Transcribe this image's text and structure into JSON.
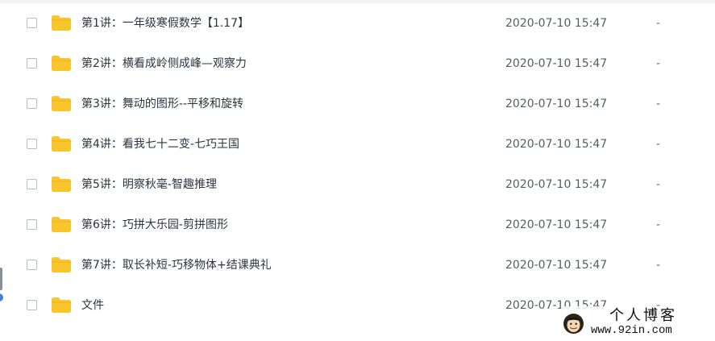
{
  "file_list": {
    "rows": [
      {
        "name": "第1讲：一年级寒假数学【1.17】",
        "date": "2020-07-10 15:47",
        "size": "-"
      },
      {
        "name": "第2讲：横看成岭侧成峰—观察力",
        "date": "2020-07-10 15:47",
        "size": "-"
      },
      {
        "name": "第3讲：舞动的图形--平移和旋转",
        "date": "2020-07-10 15:47",
        "size": "-"
      },
      {
        "name": "第4讲：看我七十二变-七巧王国",
        "date": "2020-07-10 15:47",
        "size": "-"
      },
      {
        "name": "第5讲：明察秋毫-智趣推理",
        "date": "2020-07-10 15:47",
        "size": "-"
      },
      {
        "name": "第6讲：巧拼大乐园-剪拼图形",
        "date": "2020-07-10 15:47",
        "size": "-"
      },
      {
        "name": "第7讲：取长补短-巧移物体+结课典礼",
        "date": "2020-07-10 15:47",
        "size": "-"
      },
      {
        "name": "文件",
        "date": "2020-07-10 15:47",
        "size": "-"
      }
    ]
  },
  "watermark": {
    "title": "个人博客",
    "url": "www.92in.com"
  },
  "icons": {
    "row_icon": "folder-icon",
    "watermark_logo": "cartoon-face-logo"
  },
  "colors": {
    "folder": "#f8c52c",
    "folder_tab": "#f1b51f",
    "row_text": "#2b3440",
    "meta_text": "#555d67",
    "checkbox_border": "#b7bcc3"
  }
}
